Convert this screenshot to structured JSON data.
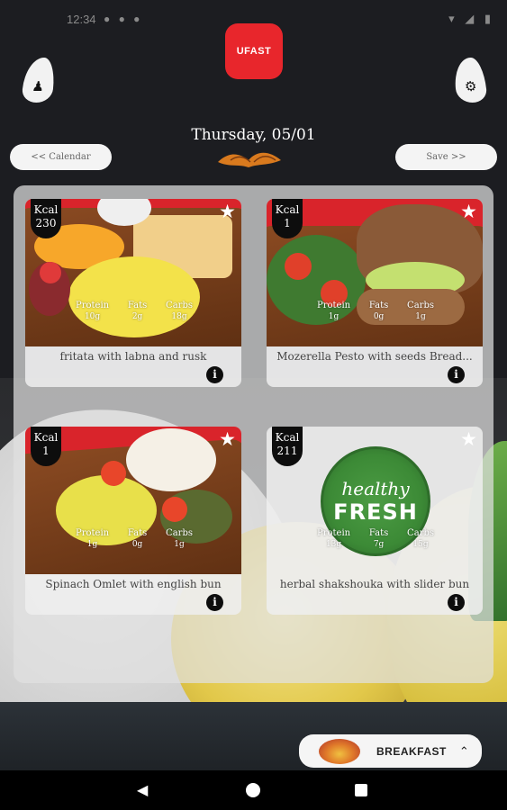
{
  "status_bar": {
    "time": "12:34",
    "left_icons": "● ● ●",
    "right_icons": "▾ ◢ ▮"
  },
  "header": {
    "logo_text": "UFAST",
    "date": "Thursday, 05/01",
    "prev_button": "<< Calendar",
    "next_button": "Save >>"
  },
  "meals": [
    {
      "kcal_label": "Kcal",
      "kcal": "230",
      "name": "fritata with labna and rusk",
      "macros": [
        {
          "label": "Protein",
          "value": "10g"
        },
        {
          "label": "Fats",
          "value": "2g"
        },
        {
          "label": "Carbs",
          "value": "18g"
        }
      ]
    },
    {
      "kcal_label": "Kcal",
      "kcal": "1",
      "name": "Mozerella Pesto with seeds Bread...",
      "macros": [
        {
          "label": "Protein",
          "value": "1g"
        },
        {
          "label": "Fats",
          "value": "0g"
        },
        {
          "label": "Carbs",
          "value": "1g"
        }
      ]
    },
    {
      "kcal_label": "Kcal",
      "kcal": "1",
      "name": "Spinach Omlet with english bun",
      "macros": [
        {
          "label": "Protein",
          "value": "1g"
        },
        {
          "label": "Fats",
          "value": "0g"
        },
        {
          "label": "Carbs",
          "value": "1g"
        }
      ]
    },
    {
      "kcal_label": "Kcal",
      "kcal": "211",
      "name": "herbal shakshouka with slider bun",
      "image_text_1": "healthy",
      "image_text_2": "FRESH",
      "macros": [
        {
          "label": "Protein",
          "value": "13g"
        },
        {
          "label": "Fats",
          "value": "7g"
        },
        {
          "label": "Carbs",
          "value": "15g"
        }
      ]
    }
  ],
  "meal_selector": {
    "label": "BREAKFAST"
  },
  "colors": {
    "brand_red": "#e8262c",
    "background": "#1c1d21",
    "badge": "#0d0d0d"
  }
}
